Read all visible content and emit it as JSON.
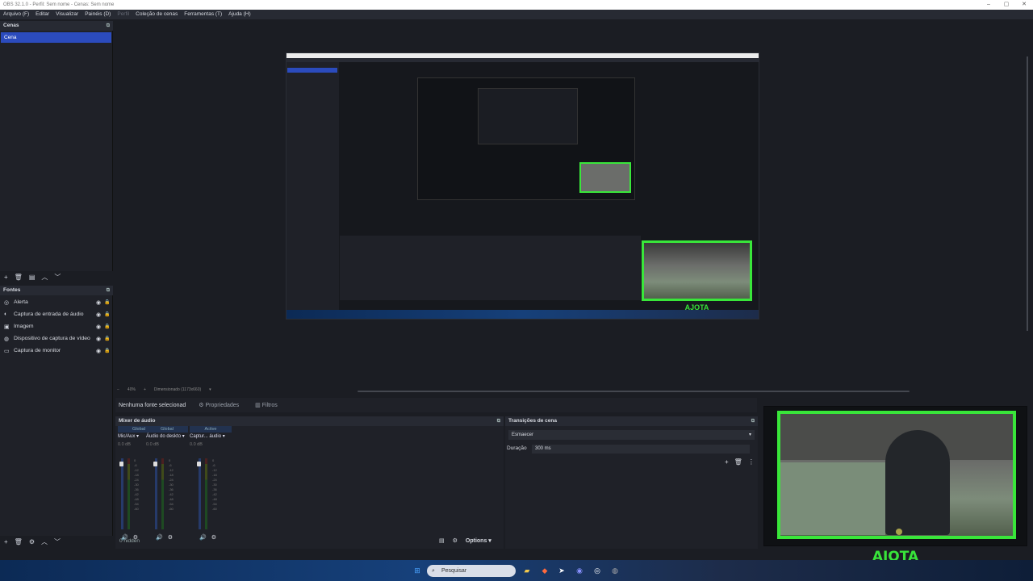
{
  "window": {
    "title": "OBS 32.1.0 - Perfil: Sem nome - Cenas: Sem nome"
  },
  "menu": [
    "Arquivo (F)",
    "Editar",
    "Visualizar",
    "Painéis (D)",
    "Perfil",
    "Coleção de cenas",
    "Ferramentas (T)",
    "Ajuda (H)"
  ],
  "scenes": {
    "title": "Cenas",
    "items": [
      "Cena"
    ]
  },
  "sources": {
    "title": "Fontes",
    "items": [
      {
        "label": "Alerta",
        "icon": "globe-icon"
      },
      {
        "label": "Captura de entrada de áudio",
        "icon": "mic-icon"
      },
      {
        "label": "Imagem",
        "icon": "image-icon"
      },
      {
        "label": "Dispositivo de captura de vídeo",
        "icon": "camera-icon"
      },
      {
        "label": "Captura de monitor",
        "icon": "monitor-icon"
      }
    ]
  },
  "preview": {
    "zoom": "40%",
    "mode": "Dimensionado (1173x660)"
  },
  "context": {
    "no_source": "Nenhuma fonte selecionad",
    "properties": "Propriedades",
    "filters": "Filtros"
  },
  "mixer": {
    "title": "Mixer de áudio",
    "channels": [
      {
        "tag": "Global",
        "name": "Mic/Aux",
        "db": "0.0 dB"
      },
      {
        "tag": "Global",
        "name": "Áudio do deskto",
        "db": "0.0 dB"
      },
      {
        "tag": "Active",
        "name": "Captur... áudio",
        "db": "0.0 dB"
      }
    ],
    "ticks": [
      "0",
      "-6",
      "-12",
      "-18",
      "-24",
      "-30",
      "-36",
      "-42",
      "-48",
      "-54",
      "-60"
    ],
    "hidden": "0 hidden",
    "options": "Options"
  },
  "transitions": {
    "title": "Transições de cena",
    "selected": "Esmaecer",
    "duration_label": "Duração",
    "duration_value": "300 ms"
  },
  "camera": {
    "brand": "AJOTA"
  },
  "taskbar": {
    "search": "Pesquisar"
  },
  "colors": {
    "accent": "#2b4bbd",
    "brand_green": "#39e63a",
    "panel": "#1f2128",
    "header": "#272a33"
  }
}
